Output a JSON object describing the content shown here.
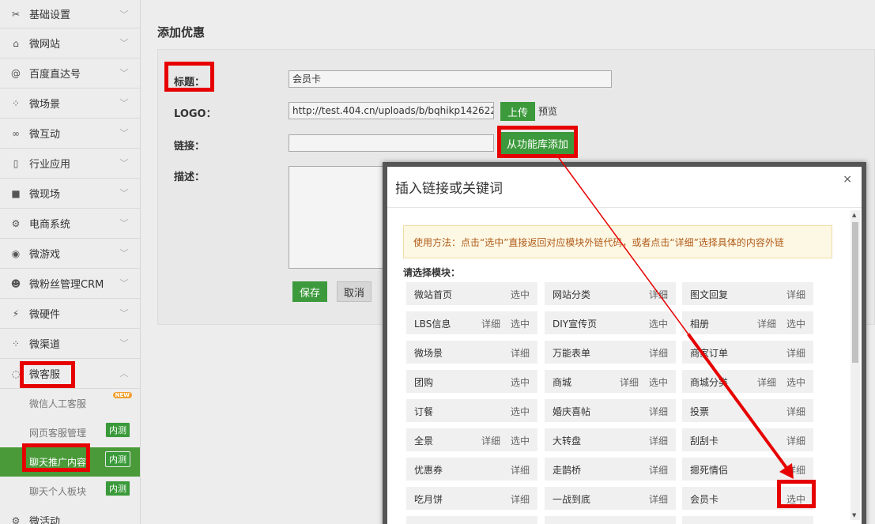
{
  "sidebar": {
    "items": [
      {
        "label": "基础设置",
        "icon": "fork-knife-icon",
        "glyph": "✂"
      },
      {
        "label": "微网站",
        "icon": "home-icon",
        "glyph": "⌂"
      },
      {
        "label": "百度直达号",
        "icon": "at-icon",
        "glyph": "@"
      },
      {
        "label": "微场景",
        "icon": "dots-icon",
        "glyph": "⁘"
      },
      {
        "label": "微互动",
        "icon": "link-icon",
        "glyph": "∞"
      },
      {
        "label": "行业应用",
        "icon": "tablet-icon",
        "glyph": "▯"
      },
      {
        "label": "微现场",
        "icon": "video-icon",
        "glyph": "■"
      },
      {
        "label": "电商系统",
        "icon": "gear-icon",
        "glyph": "⚙"
      },
      {
        "label": "微游戏",
        "icon": "gamepad-icon",
        "glyph": "◉"
      },
      {
        "label": "微粉丝管理CRM",
        "icon": "users-icon",
        "glyph": "☻"
      },
      {
        "label": "微硬件",
        "icon": "usb-icon",
        "glyph": "⚡"
      },
      {
        "label": "微渠道",
        "icon": "share-icon",
        "glyph": "⁘"
      },
      {
        "label": "微客服",
        "icon": "chat-icon",
        "glyph": "◌"
      }
    ],
    "sub_items": [
      {
        "label": "微信人工客服",
        "badge": "NEW"
      },
      {
        "label": "网页客服管理",
        "badge": "内测"
      },
      {
        "label": "聊天推广内容",
        "badge": "内测"
      },
      {
        "label": "聊天个人板块",
        "badge": "内测"
      }
    ],
    "last_item": {
      "label": "微活动"
    }
  },
  "main": {
    "title": "添加优惠",
    "form": {
      "title_label": "标题：",
      "title_value": "会员卡",
      "logo_label": "LOGO：",
      "logo_value": "http://test.404.cn/uploads/b/bqhikp142622",
      "upload_button": "上传",
      "preview_link": "预览",
      "link_label": "链接：",
      "link_value": "",
      "library_button": "从功能库添加",
      "desc_label": "描述：",
      "save_button": "保存",
      "cancel_button": "取消"
    }
  },
  "modal": {
    "title": "插入链接或关键词",
    "close": "×",
    "tip": "使用方法：点击“选中”直接返回对应模块外链代码，或者点击“详细”选择具体的内容外链",
    "choose_label": "请选择模块：",
    "modules": [
      [
        {
          "name": "微站首页",
          "acts": [
            "选中"
          ]
        },
        {
          "name": "网站分类",
          "acts": [
            "详细"
          ]
        },
        {
          "name": "图文回复",
          "acts": [
            "详细"
          ]
        }
      ],
      [
        {
          "name": "LBS信息",
          "acts": [
            "详细",
            "选中"
          ]
        },
        {
          "name": "DIY宣传页",
          "acts": [
            "选中"
          ]
        },
        {
          "name": "相册",
          "acts": [
            "详细",
            "选中"
          ]
        }
      ],
      [
        {
          "name": "微场景",
          "acts": [
            "详细"
          ]
        },
        {
          "name": "万能表单",
          "acts": [
            "详细"
          ]
        },
        {
          "name": "商家订单",
          "acts": [
            "详细"
          ]
        }
      ],
      [
        {
          "name": "团购",
          "acts": [
            "选中"
          ]
        },
        {
          "name": "商城",
          "acts": [
            "详细",
            "选中"
          ]
        },
        {
          "name": "商城分类",
          "acts": [
            "详细",
            "选中"
          ]
        }
      ],
      [
        {
          "name": "订餐",
          "acts": [
            "选中"
          ]
        },
        {
          "name": "婚庆喜帖",
          "acts": [
            "详细"
          ]
        },
        {
          "name": "投票",
          "acts": [
            "详细"
          ]
        }
      ],
      [
        {
          "name": "全景",
          "acts": [
            "详细",
            "选中"
          ]
        },
        {
          "name": "大转盘",
          "acts": [
            "详细"
          ]
        },
        {
          "name": "刮刮卡",
          "acts": [
            "详细"
          ]
        }
      ],
      [
        {
          "name": "优惠券",
          "acts": [
            "详细"
          ]
        },
        {
          "name": "走鹊桥",
          "acts": [
            "详细"
          ]
        },
        {
          "name": "摁死情侣",
          "acts": [
            "详细"
          ]
        }
      ],
      [
        {
          "name": "吃月饼",
          "acts": [
            "详细"
          ]
        },
        {
          "name": "一战到底",
          "acts": [
            "详细"
          ]
        },
        {
          "name": "会员卡",
          "acts": [
            "选中"
          ]
        }
      ]
    ]
  },
  "colors": {
    "accent_green": "#3c9a3c",
    "highlight_red": "#e60000",
    "tip_text": "#b05a18"
  }
}
